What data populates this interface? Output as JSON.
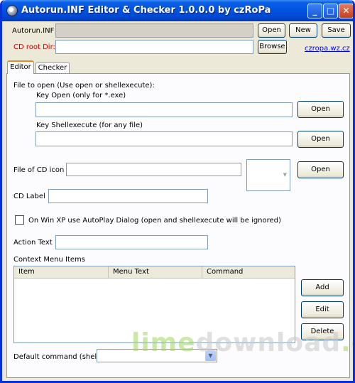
{
  "window": {
    "title": "Autorun.INF Editor & Checker 1.0.0.0 by czRoPa",
    "controls": {
      "minimize": "_",
      "maximize": "□",
      "close": "✕"
    }
  },
  "top": {
    "autorun_label": "Autorun.INF",
    "autorun_value": "",
    "open_button": "Open",
    "new_button": "New",
    "save_button": "Save",
    "cdroot_label": "CD root Dir:",
    "cdroot_value": "",
    "browse_button": "Browse",
    "website_link": "czropa.wz.cz"
  },
  "tabs": [
    {
      "label": "Editor",
      "active": true
    },
    {
      "label": "Checker",
      "active": false
    }
  ],
  "editor": {
    "file_to_open_label": "File to open (Use open or shellexecute):",
    "key_open_label": "Key Open (only for *.exe)",
    "key_open_value": "",
    "key_open_button": "Open",
    "key_shell_label": "Key Shellexecute (for any file)",
    "key_shell_value": "",
    "key_shell_button": "Open",
    "cd_icon_label": "File of CD icon",
    "cd_icon_value": "",
    "cd_icon_button": "Open",
    "cd_label_label": "CD Label",
    "cd_label_value": "",
    "autoplay_checkbox_label": "On Win XP use AutoPlay Dialog (open and shellexecute will be ignored)",
    "autoplay_checked": false,
    "action_text_label": "Action Text",
    "action_text_value": "",
    "context_menu_label": "Context Menu Items",
    "columns": [
      "Item",
      "Menu Text",
      "Command"
    ],
    "rows": [],
    "add_button": "Add",
    "edit_button": "Edit",
    "delete_button": "Delete",
    "default_command_label": "Default command (shell)",
    "default_command_value": ""
  },
  "watermark": {
    "part1": "lime",
    "part2": "download",
    "part3": ".com"
  }
}
